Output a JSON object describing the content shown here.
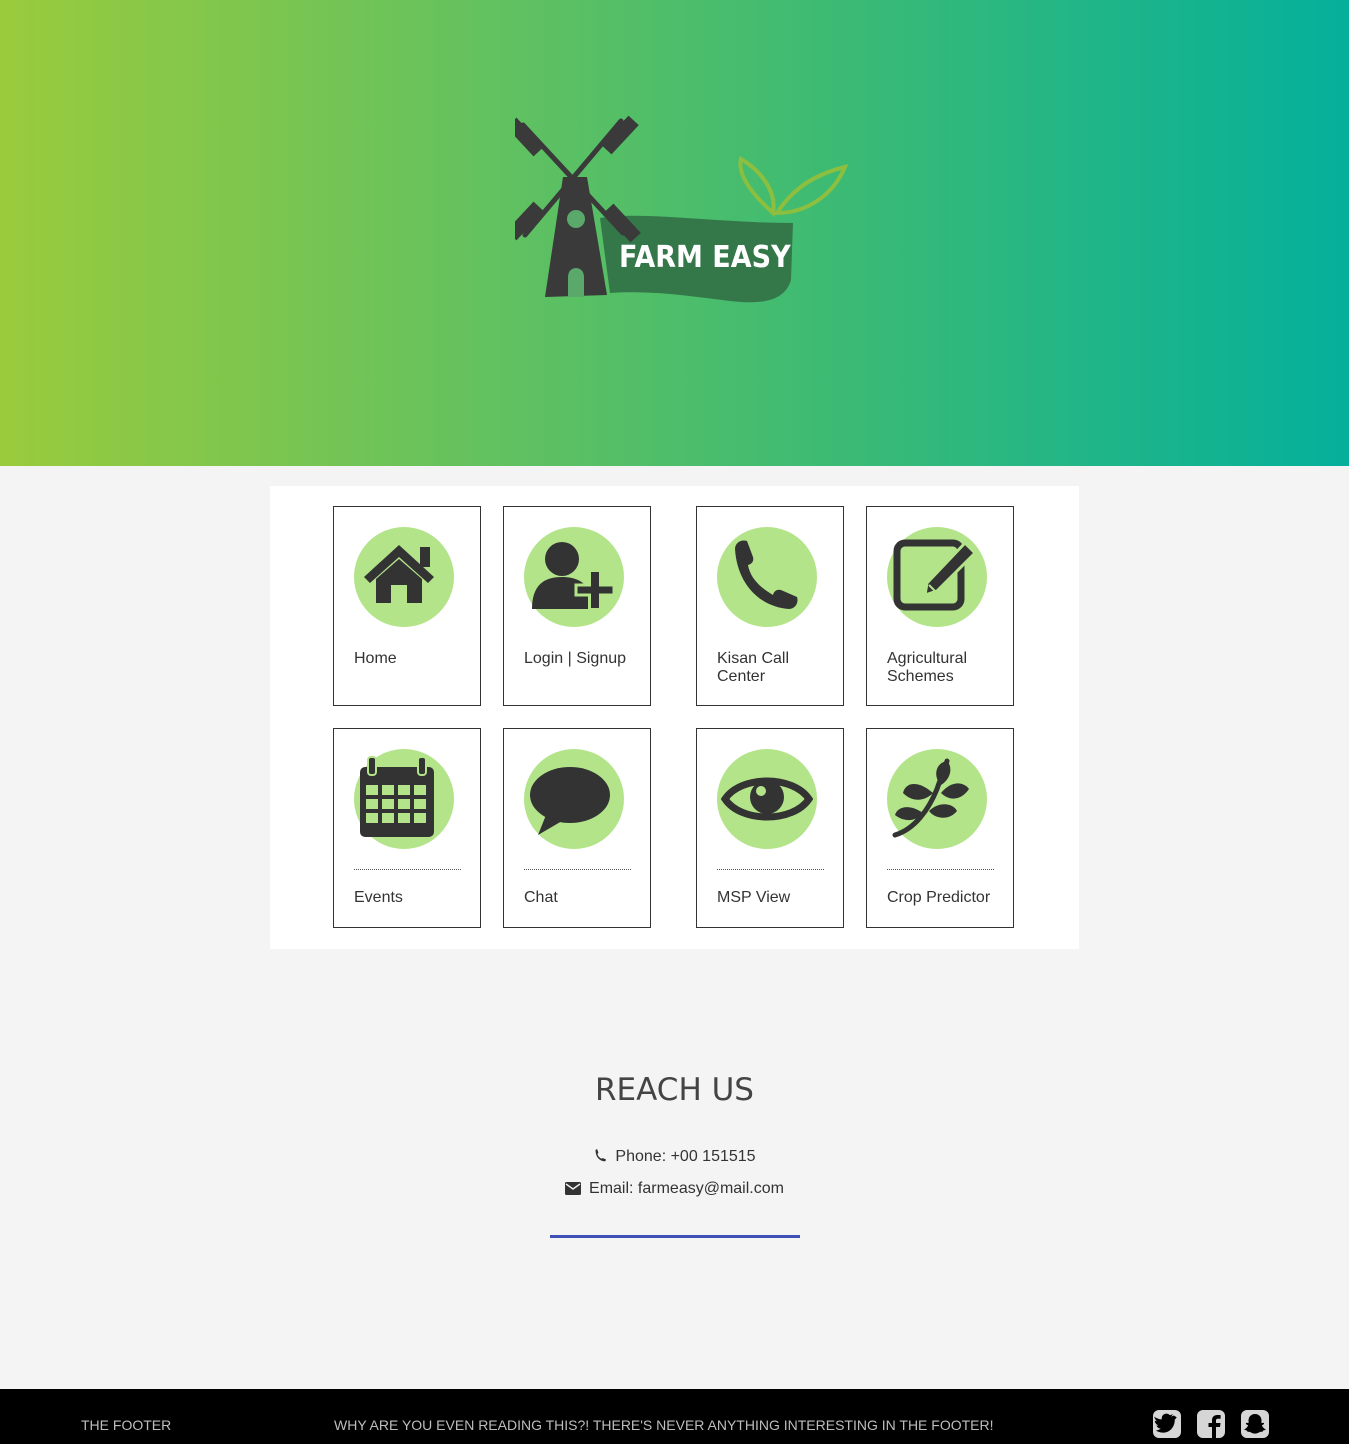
{
  "brand": {
    "name": "FARM EASY"
  },
  "colors": {
    "accent_circle": "#b3e48a",
    "icon": "#333333",
    "divider": "#3f51b5",
    "footer_bg": "#000000"
  },
  "menu": {
    "items": [
      {
        "label": "Home",
        "icon": "home-icon"
      },
      {
        "label": "Login | Signup",
        "icon": "add-user-icon"
      },
      {
        "label": "Kisan Call Center",
        "icon": "phone-icon"
      },
      {
        "label": "Agricultural Schemes",
        "icon": "edit-icon"
      },
      {
        "label": "Events",
        "icon": "calendar-icon"
      },
      {
        "label": "Chat",
        "icon": "chat-bubble-icon"
      },
      {
        "label": "MSP View",
        "icon": "eye-icon"
      },
      {
        "label": "Crop Predictor",
        "icon": "leaf-icon"
      }
    ]
  },
  "reach": {
    "title": "REACH US",
    "phone": "Phone: +00 151515",
    "email": "Email: farmeasy@mail.com"
  },
  "footer": {
    "left": "THE FOOTER",
    "message": "WHY ARE YOU EVEN READING THIS?! THERE'S NEVER ANYTHING INTERESTING IN THE FOOTER!",
    "social": [
      "twitter-icon",
      "facebook-icon",
      "snapchat-icon"
    ]
  }
}
